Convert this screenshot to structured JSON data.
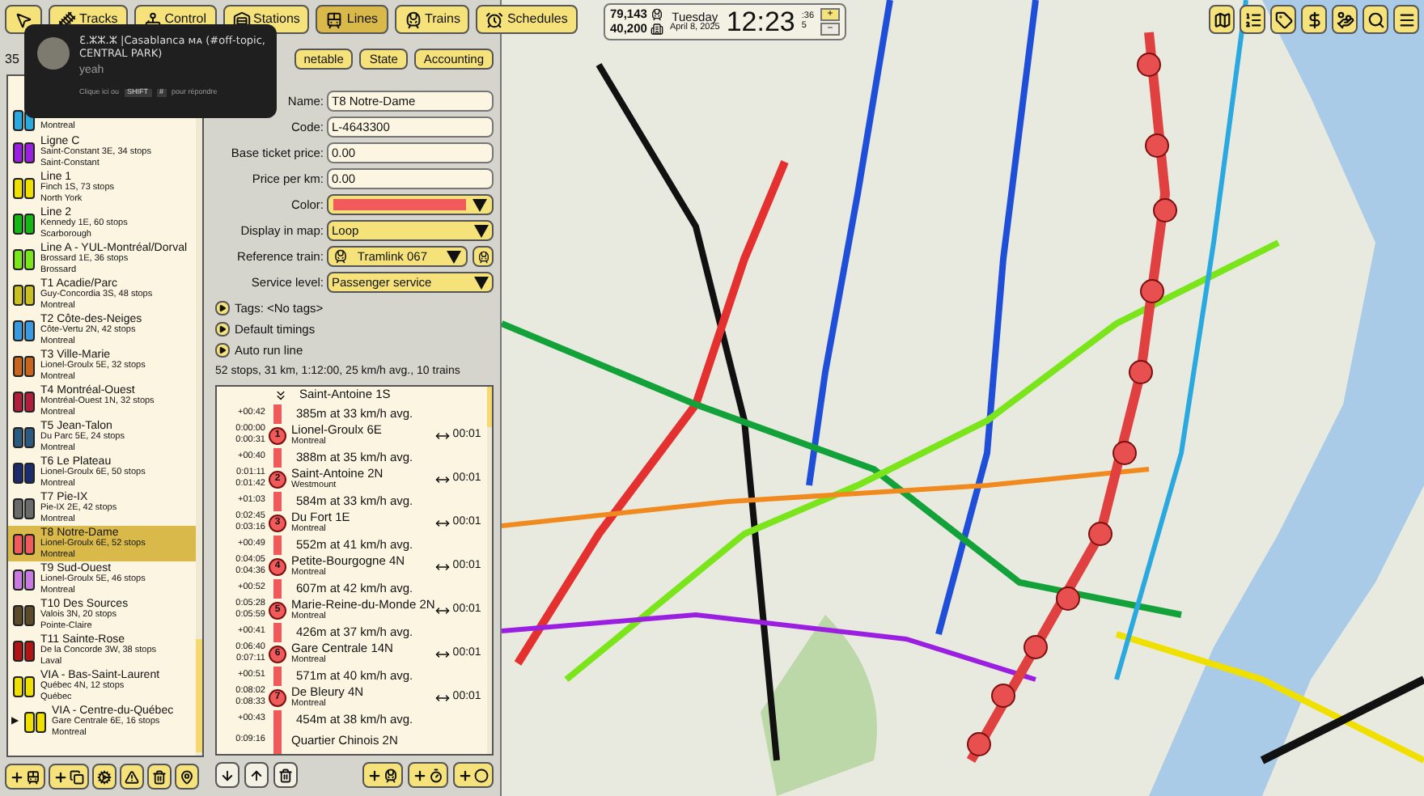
{
  "toolbar": [
    {
      "kind": "cursor",
      "selected": false
    },
    {
      "kind": "tracks",
      "label": "Tracks",
      "selected": false
    },
    {
      "kind": "control",
      "label": "Control",
      "selected": false
    },
    {
      "kind": "stations",
      "label": "Stations",
      "selected": false
    },
    {
      "kind": "lines",
      "label": "Lines",
      "selected": true
    },
    {
      "kind": "trains",
      "label": "Trains",
      "selected": false
    },
    {
      "kind": "schedules",
      "label": "Schedules",
      "selected": false
    }
  ],
  "status": {
    "trains": "79,143",
    "passengers": "40,200",
    "weekday": "Tuesday",
    "date": "April 8, 2025",
    "time": "12:23",
    "seconds": ":36",
    "speed": "5",
    "speed_up": "+",
    "speed_down": "−"
  },
  "right_toolbar": [
    {
      "kind": "map"
    },
    {
      "kind": "order"
    },
    {
      "kind": "tag"
    },
    {
      "kind": "money"
    },
    {
      "kind": "income"
    },
    {
      "kind": "search"
    },
    {
      "kind": "menu"
    }
  ],
  "notification": {
    "title": "Ɛ.ⵣⵣ.ⵣ |Casablanca ᴍᴀ (#off-topic, CENTRAL PARK)",
    "message": "yeah",
    "hint_before": "Clique ici ou",
    "key_1": "SHIFT",
    "key_2": "#",
    "hint_after": "pour répondre"
  },
  "line_list": {
    "count": "35",
    "items": [
      {
        "city": "Montreal",
        "color": "#29a9e0",
        "selected": false
      },
      {
        "name": "Ligne C",
        "info": "Saint-Constant 3E, 34 stops",
        "city": "Saint-Constant",
        "color": "#9b1fe0",
        "selected": false
      },
      {
        "name": "Line 1",
        "info": "Finch 1S, 73 stops",
        "city": "North York",
        "color": "#f0e000",
        "selected": false
      },
      {
        "name": "Line 2",
        "info": "Kennedy 1E, 60 stops",
        "city": "Scarborough",
        "color": "#14b814",
        "selected": false
      },
      {
        "name": "Line A - YUL-Montréal/Dorval",
        "info": "Brossard 1E, 36 stops",
        "city": "Brossard",
        "color": "#7be51c",
        "selected": false
      },
      {
        "name": "T1 Acadie/Parc",
        "info": "Guy-Concordia 3S, 48 stops",
        "city": "Montreal",
        "color": "#c8c020",
        "selected": false
      },
      {
        "name": "T2 Côte-des-Neiges",
        "info": "Côte-Vertu 2N, 42 stops",
        "city": "Montreal",
        "color": "#3a9ae0",
        "selected": false
      },
      {
        "name": "T3 Ville-Marie",
        "info": "Lionel-Groulx 5E, 32 stops",
        "city": "Montreal",
        "color": "#c8641e",
        "selected": false
      },
      {
        "name": "T4 Montréal-Ouest",
        "info": "Montréal-Ouest 1N, 32 stops",
        "city": "Montreal",
        "color": "#b01e3c",
        "selected": false
      },
      {
        "name": "T5 Jean-Talon",
        "info": "Du Parc 5E, 24 stops",
        "city": "Montreal",
        "color": "#2a5a80",
        "selected": false
      },
      {
        "name": "T6 Le Plateau",
        "info": "Lionel-Groulx 6E, 50 stops",
        "city": "Montreal",
        "color": "#1e2a6e",
        "selected": false
      },
      {
        "name": "T7 Pie-IX",
        "info": "Pie-IX 2E, 42 stops",
        "city": "Montreal",
        "color": "#6a6a6a",
        "selected": false
      },
      {
        "name": "T8 Notre-Dame",
        "info": "Lionel-Groulx 6E, 52 stops",
        "city": "Montreal",
        "color": "#f05a5a",
        "selected": true
      },
      {
        "name": "T9 Sud-Ouest",
        "info": "Lionel-Groulx 5E, 46 stops",
        "city": "Montreal",
        "color": "#c87ae0",
        "selected": false
      },
      {
        "name": "T10 Des Sources",
        "info": "Valois 3N, 20 stops",
        "city": "Pointe-Claire",
        "color": "#5a4a2a",
        "selected": false
      },
      {
        "name": "T11 Sainte-Rose",
        "info": "De la Concorde 3W, 38 stops",
        "city": "Laval",
        "color": "#b01414",
        "selected": false
      },
      {
        "name": "VIA - Bas-Saint-Laurent",
        "info": "Québec 4N, 12 stops",
        "city": "Québec",
        "color": "#f0e000",
        "selected": false
      },
      {
        "name": "VIA - Centre-du-Québec",
        "info": "Gare Centrale 6E, 16 stops",
        "city": "Montreal",
        "color": "#f0e000",
        "selected": false,
        "marker": "▶"
      }
    ]
  },
  "list_buttons": [
    {
      "kind": "add-line"
    },
    {
      "kind": "add-copy"
    },
    {
      "kind": "gears"
    },
    {
      "kind": "warning"
    },
    {
      "kind": "trash"
    },
    {
      "kind": "pin"
    }
  ],
  "tabs": [
    {
      "label": "netable",
      "selected": false
    },
    {
      "label": "State",
      "selected": false
    },
    {
      "label": "Accounting",
      "selected": false
    }
  ],
  "fields": [
    {
      "kind": "text",
      "label": "Name:",
      "value": "T8 Notre-Dame"
    },
    {
      "kind": "text",
      "label": "Code:",
      "value": "L-4643300"
    },
    {
      "kind": "text",
      "label": "Base ticket price:",
      "value": "0.00"
    },
    {
      "kind": "text",
      "label": "Price per km:",
      "value": "0.00"
    },
    {
      "kind": "color",
      "label": "Color:",
      "color": "#f05a5a"
    },
    {
      "kind": "select",
      "label": "Display in map:",
      "value": "Loop"
    },
    {
      "kind": "train",
      "label": "Reference train:",
      "value": "Tramlink 067"
    },
    {
      "kind": "select",
      "label": "Service level:",
      "value": "Passenger service"
    }
  ],
  "expanders": [
    "Tags: <No tags>",
    "Default timings",
    "Auto run line"
  ],
  "summary": "52 stops, 31 km, 1:12:00, 25 km/h avg., 10 trains",
  "route": {
    "start": "Saint-Antoine 1S",
    "stops": [
      {
        "delta": "+00:42",
        "segment": "385m at 33 km/h avg.",
        "number": "1",
        "name": "Lionel-Groulx 6E",
        "city": "Montreal",
        "arrive": "0:00:00",
        "depart": "0:00:31",
        "dwell": "00:01"
      },
      {
        "delta": "+00:40",
        "segment": "388m at 35 km/h avg.",
        "number": "2",
        "name": "Saint-Antoine 2N",
        "city": "Westmount",
        "arrive": "0:01:11",
        "depart": "0:01:42",
        "dwell": "00:01"
      },
      {
        "delta": "+01:03",
        "segment": "584m at 33 km/h avg.",
        "number": "3",
        "name": "Du Fort 1E",
        "city": "Montreal",
        "arrive": "0:02:45",
        "depart": "0:03:16",
        "dwell": "00:01"
      },
      {
        "delta": "+00:49",
        "segment": "552m at 41 km/h avg.",
        "number": "4",
        "name": "Petite-Bourgogne 4N",
        "city": "Montreal",
        "arrive": "0:04:05",
        "depart": "0:04:36",
        "dwell": "00:01"
      },
      {
        "delta": "+00:52",
        "segment": "607m at 42 km/h avg.",
        "number": "5",
        "name": "Marie-Reine-du-Monde 2N",
        "city": "Montreal",
        "arrive": "0:05:28",
        "depart": "0:05:59",
        "dwell": "00:01"
      },
      {
        "delta": "+00:41",
        "segment": "426m at 37 km/h avg.",
        "number": "6",
        "name": "Gare Centrale 14N",
        "city": "Montreal",
        "arrive": "0:06:40",
        "depart": "0:07:11",
        "dwell": "00:01"
      },
      {
        "delta": "+00:51",
        "segment": "571m at 40 km/h avg.",
        "number": "7",
        "name": "De Bleury 4N",
        "city": "Montreal",
        "arrive": "0:08:02",
        "depart": "0:08:33",
        "dwell": "00:01"
      },
      {
        "delta": "+00:43",
        "segment": "454m at 38 km/h avg.",
        "name": "Quartier Chinois 2N",
        "arrive": "0:09:16"
      }
    ]
  },
  "route_buttons": [
    {
      "kind": "down"
    },
    {
      "kind": "up"
    },
    {
      "kind": "trash"
    },
    {
      "kind": "add-train"
    },
    {
      "kind": "add-timer"
    },
    {
      "kind": "add-stop"
    }
  ]
}
